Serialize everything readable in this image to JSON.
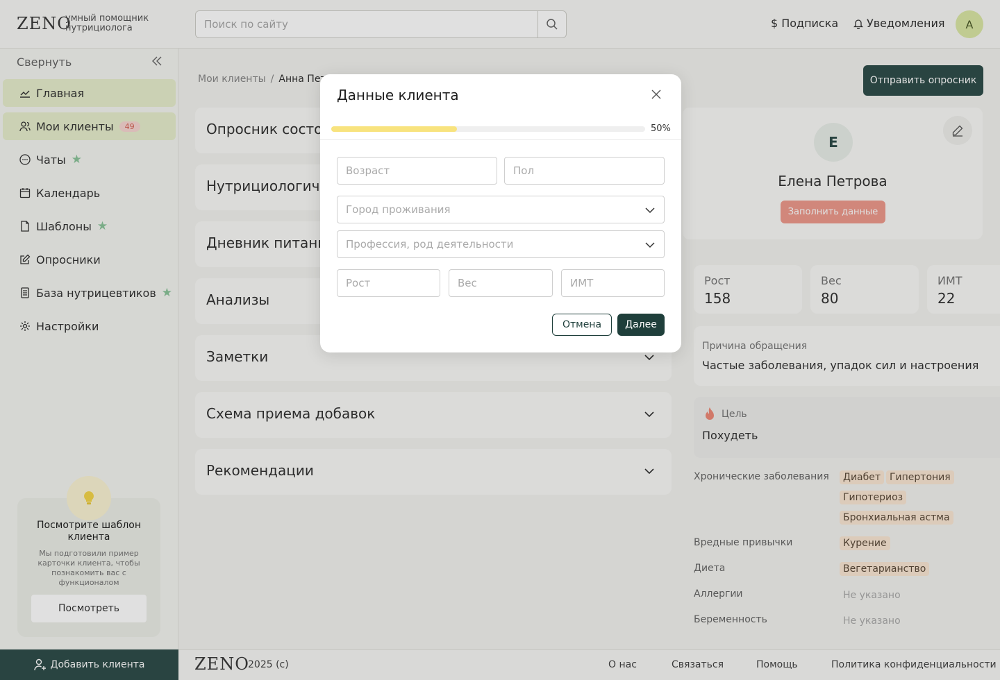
{
  "header": {
    "logo": "ZENO",
    "tagline": "умный помощник нутрициолога",
    "search_placeholder": "Поиск по сайту",
    "subscription": "Подписка",
    "notifications": "Уведомления",
    "user_initial": "A"
  },
  "sidebar": {
    "collapse_label": "Свернуть",
    "items": [
      {
        "label": "Главная",
        "icon": "chart-line-icon",
        "active": true
      },
      {
        "label": "Мои клиенты",
        "icon": "users-icon",
        "active": true,
        "badge": "49"
      },
      {
        "label": "Чаты",
        "icon": "chat-icon",
        "star": true
      },
      {
        "label": "Календарь",
        "icon": "calendar-icon"
      },
      {
        "label": "Шаблоны",
        "icon": "file-icon",
        "star": true
      },
      {
        "label": "Опросники",
        "icon": "edit-icon"
      },
      {
        "label": "База нутрицевтиков",
        "icon": "book-icon",
        "star": true
      },
      {
        "label": "Настройки",
        "icon": "gear-icon"
      }
    ],
    "tip": {
      "title": "Посмотрите шаблон клиента",
      "text": "Мы подготовили пример карточки клиента, чтобы познакомить вас с функционалом",
      "button": "Посмотреть"
    },
    "add_client": "Добавить клиента"
  },
  "main": {
    "breadcrumb": {
      "parent": "Мои клиенты",
      "separator": "/",
      "current": "Анна Петр"
    },
    "send_survey": "Отправить опросник",
    "accordions": [
      "Опросник  состо",
      "Нутрициологиче",
      "Дневник питани",
      "Анализы",
      "Заметки",
      "Схема приема добавок",
      "Рекомендации"
    ]
  },
  "profile": {
    "initial": "Е",
    "name": "Елена Петрова",
    "fill_button": "Заполнить данные",
    "stats": [
      {
        "label": "Рост",
        "value": "158"
      },
      {
        "label": "Вес",
        "value": "80"
      },
      {
        "label": "ИМТ",
        "value": "22"
      }
    ],
    "reason_label": "Причина обращения",
    "reason_value": "Частые заболевания, упадок сил и настроения",
    "goal_label": "Цель",
    "goal_value": "Похудеть",
    "chronic_label": "Хронические заболевания",
    "chronic_tags": [
      "Диабет",
      "Гипертония",
      "Гипотериоз",
      "Бронхиальная астма"
    ],
    "habits_label": "Вредные привычки",
    "habits_tags": [
      "Курение"
    ],
    "diet_label": "Диета",
    "diet_tags": [
      "Вегетарианство"
    ],
    "allergy_label": "Аллергии",
    "allergy_value": "Не указано",
    "pregnancy_label": "Беременность",
    "pregnancy_value": "Не указано"
  },
  "footer": {
    "logo": "ZENO",
    "year": "2025 (c)",
    "links": [
      "О нас",
      "Связаться",
      "Помощь",
      "Политика конфиденциальности"
    ]
  },
  "modal": {
    "title": "Данные клиента",
    "progress_value": 40,
    "progress_label": "50%",
    "age_placeholder": "Возраст",
    "gender_placeholder": "Пол",
    "city_placeholder": "Город проживания",
    "profession_placeholder": "Профессия, род деятельности",
    "height_placeholder": "Рост",
    "weight_placeholder": "Вес",
    "bmi_placeholder": "ИМТ",
    "cancel": "Отмена",
    "next": "Далее"
  },
  "colors": {
    "brand_dark": "#2f4e4a",
    "active_nav": "#e7eecd",
    "accent_salmon": "#ee9a8d",
    "progress": "#f8e37e",
    "tag_bg": "#fbe7d4"
  }
}
